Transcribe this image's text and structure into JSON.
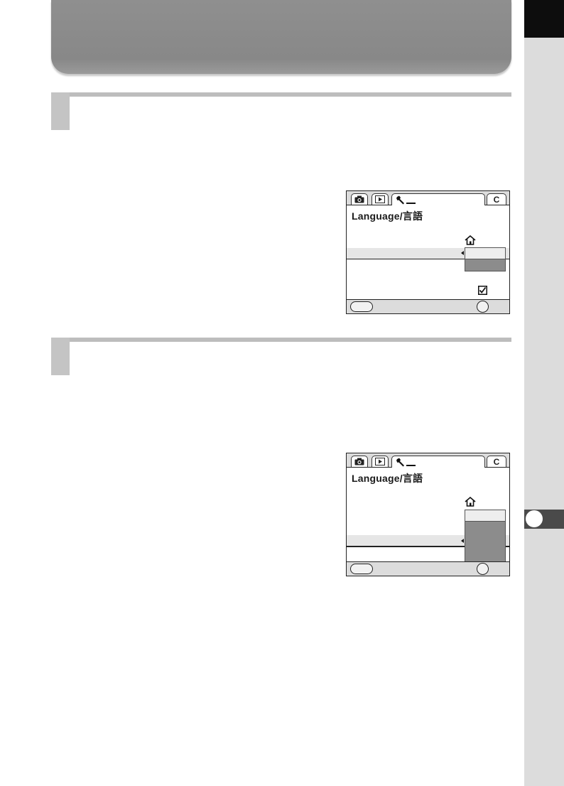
{
  "screens": [
    {
      "menu_title": "Language/言語"
    },
    {
      "menu_title": "Language/言語"
    }
  ],
  "icons": {
    "tabs": [
      "camera-icon",
      "playback-icon",
      "wrench-icon",
      "custom-c-icon"
    ],
    "tab_c_label": "C",
    "home": "home-icon",
    "check": "checkbox-checked-icon",
    "menu_button": "menu-button-icon",
    "ok_button": "ok-button-icon"
  },
  "colors": {
    "title_banner": "#8f8f8f",
    "side_strip": "#dcdcdc",
    "side_tab": "#0d0d0d",
    "chapter_tab": "#4a4a4a",
    "step_marker": "#c4c4c4",
    "highlight_cell": "#8c8c8c"
  }
}
